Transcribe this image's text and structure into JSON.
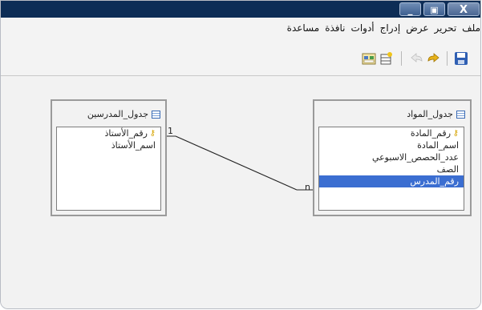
{
  "window": {
    "buttons": {
      "minimize": "_",
      "maximize": "▣",
      "close": "X"
    }
  },
  "menu": [
    "ملف",
    "تحرير",
    "عرض",
    "إدراج",
    "أدوات",
    "نافذة",
    "مساعدة"
  ],
  "toolbar": {
    "icons": [
      "save-icon",
      "redo-icon",
      "undo-icon",
      "new-table-icon",
      "add-tables-icon"
    ]
  },
  "tables": {
    "left": {
      "name": "جدول_المدرسين",
      "fields": [
        {
          "label": "رقم_الأستاذ",
          "key": true,
          "selected": false
        },
        {
          "label": "اسم_الأستاذ",
          "key": false,
          "selected": false
        }
      ]
    },
    "right": {
      "name": "جدول_المواد",
      "fields": [
        {
          "label": "رقم_المادة",
          "key": true,
          "selected": false
        },
        {
          "label": "اسم_المادة",
          "key": false,
          "selected": false
        },
        {
          "label": "عدد_الحصص_الاسبوعي",
          "key": false,
          "selected": false
        },
        {
          "label": "الصف",
          "key": false,
          "selected": false
        },
        {
          "label": "رقم_المدرس",
          "key": false,
          "selected": true
        }
      ]
    }
  },
  "relationship": {
    "one_side": "1",
    "many_side": "n"
  },
  "colors": {
    "titlebar": "#0d2d56",
    "selection": "#3b6ed1",
    "background": "#f2f2f2"
  }
}
